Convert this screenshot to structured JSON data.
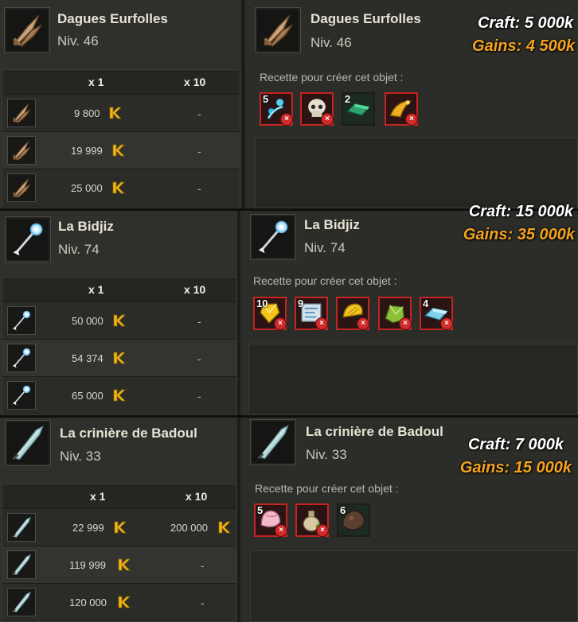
{
  "columns": {
    "x1": "x 1",
    "x10": "x 10"
  },
  "recipe_label": "Recette pour créer cet objet :",
  "colors": {
    "accent_gains": "#f5a31f",
    "missing_border": "#c32424"
  },
  "sections": [
    {
      "name": "Dagues Eurfolles",
      "level": "Niv. 46",
      "craft": "Craft: 5 000k",
      "gains": "Gains: 4 500k",
      "icon": "dagger-icon",
      "rows": [
        {
          "x1": "9 800",
          "x10": "-"
        },
        {
          "x1": "19 999",
          "x10": "-"
        },
        {
          "x1": "25 000",
          "x10": "-"
        }
      ],
      "ingredients": [
        {
          "qty": "5",
          "icon": "blue-drops-icon",
          "missing": true
        },
        {
          "qty": "",
          "icon": "skull-icon",
          "missing": true
        },
        {
          "qty": "2",
          "icon": "emerald-bar-icon",
          "missing": false
        },
        {
          "qty": "",
          "icon": "golden-horn-icon",
          "missing": true
        }
      ]
    },
    {
      "name": "La Bidjiz",
      "level": "Niv. 74",
      "craft": "Craft: 15 000k",
      "gains": "Gains: 35 000k",
      "icon": "staff-icon",
      "rows": [
        {
          "x1": "50 000",
          "x10": "-"
        },
        {
          "x1": "54 374",
          "x10": "-"
        },
        {
          "x1": "65 000",
          "x10": "-"
        }
      ],
      "ingredients": [
        {
          "qty": "10",
          "icon": "yellow-crystal-icon",
          "missing": true
        },
        {
          "qty": "9",
          "icon": "map-scroll-icon",
          "missing": true
        },
        {
          "qty": "",
          "icon": "gold-shell-icon",
          "missing": true
        },
        {
          "qty": "",
          "icon": "green-stone-icon",
          "missing": true
        },
        {
          "qty": "4",
          "icon": "ice-bar-icon",
          "missing": true
        }
      ]
    },
    {
      "name": "La crinière de Badoul",
      "level": "Niv. 33",
      "craft": "Craft: 7 000k",
      "gains": "Gains: 15 000k",
      "icon": "feather-sword-icon",
      "rows": [
        {
          "x1": "22 999",
          "x10": "200 000"
        },
        {
          "x1": "119 999",
          "x10": "-"
        },
        {
          "x1": "120 000",
          "x10": "-"
        }
      ],
      "ingredients": [
        {
          "qty": "5",
          "icon": "pink-shell-icon",
          "missing": true
        },
        {
          "qty": "",
          "icon": "potion-vase-icon",
          "missing": true
        },
        {
          "qty": "6",
          "icon": "brown-rock-icon",
          "missing": false
        }
      ]
    }
  ]
}
